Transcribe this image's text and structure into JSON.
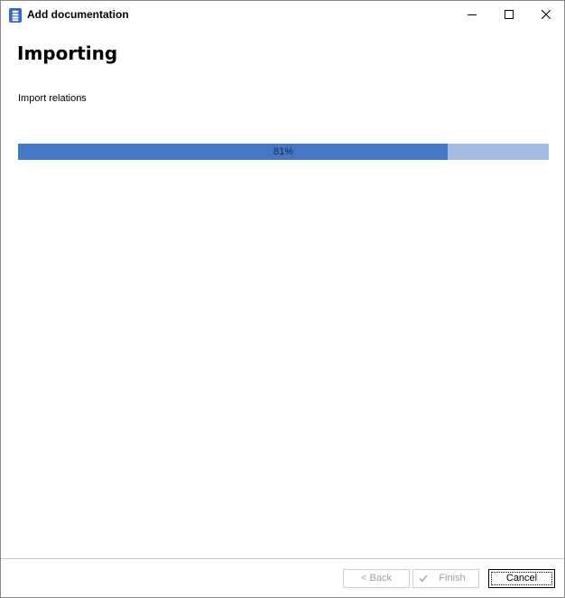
{
  "window": {
    "title": "Add documentation",
    "app_icon": "database-icon",
    "controls": [
      "minimize-icon",
      "maximize-icon",
      "close-icon"
    ]
  },
  "page": {
    "heading": "Importing",
    "status": "Import relations"
  },
  "progress": {
    "percent": 81,
    "label": "81%",
    "fill_color": "#4577c7",
    "track_color": "#a4bde3"
  },
  "footer": {
    "back_label": "< Back",
    "finish_label": "Finish",
    "cancel_label": "Cancel",
    "finish_icon": "checkmark-icon"
  }
}
